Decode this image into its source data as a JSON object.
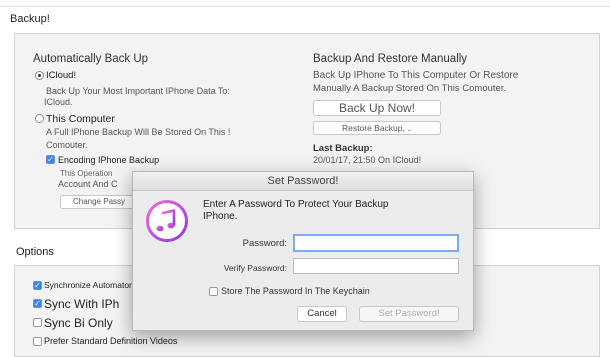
{
  "backup": {
    "section_title": "Backup!",
    "auto": {
      "heading": "Automatically Back Up",
      "icloud_label": "ICloud!",
      "icloud_desc_1": "Back Up Your Most Important IPhone Data To:",
      "icloud_desc_2": "ICloud.",
      "computer_label": "This Computer",
      "computer_desc_1": "A Full IPhone Backup Will Be Stored On This !",
      "computer_desc_2": "Comouter.",
      "encrypt_label": "Encoding IPhone Backup",
      "encrypt_desc_1": "This Operation",
      "encrypt_desc_2": "Account And C",
      "change_password_label": "Change Passy"
    },
    "manual": {
      "heading": "Backup And Restore Manually",
      "desc_1": "Back Up IPhone To This Computer Or Restore",
      "desc_2": "Manually A Backup Stored On This Comouter.",
      "back_up_now_label": "Back Up Now!",
      "restore_label": "Restore Backup, ..",
      "last_backup_heading": "Last Backup:",
      "last_backup_value": "20/01/17, 21:50 On ICloud!"
    }
  },
  "options": {
    "section_title": "Options",
    "items": [
      {
        "label": "Synchronize Automaton",
        "checked": true
      },
      {
        "label": "Sync With IPh",
        "checked": true
      },
      {
        "label": "Sync Bi Only",
        "checked": false
      },
      {
        "label": "Prefer Standard Definition Videos",
        "checked": false
      }
    ]
  },
  "dialog": {
    "title": "Set Password!",
    "message_1": "Enter A Password To Protect Your Backup",
    "message_2": "IPhone.",
    "password_label": "Password:",
    "password_value": "",
    "verify_label": "Verify Password:",
    "verify_value": "",
    "keychain_label": "Store The Password In The Keychain",
    "cancel_label": "Cancel",
    "set_password_label": "Set Password!"
  },
  "colors": {
    "accent": "#3b86e8",
    "focus_ring": "#7aaef0",
    "music_icon": "#c03bd6"
  },
  "icons": {
    "dialog_icon": "itunes-music-icon"
  }
}
